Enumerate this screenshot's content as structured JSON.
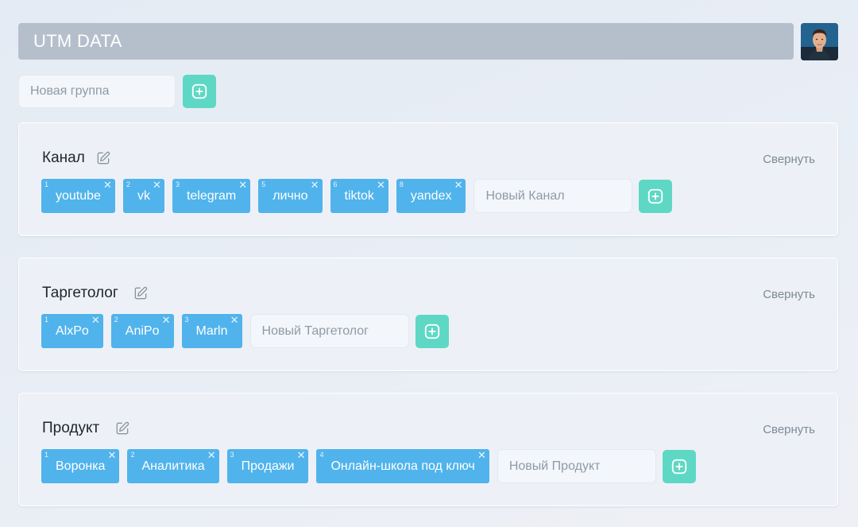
{
  "header": {
    "title": "UTM DATA"
  },
  "new_group": {
    "placeholder": "Новая группа"
  },
  "icons": {
    "add": "plus-square-icon",
    "edit": "pencil-square-icon",
    "remove": "close-icon",
    "avatar": "user-avatar"
  },
  "colors": {
    "tag": "#50b3ec",
    "add_button": "#5ed8c4",
    "header_bar": "#b5bfcc"
  },
  "groups": [
    {
      "title": "Канал",
      "collapse": "Свернуть",
      "tags": [
        {
          "num": "1",
          "label": "youtube"
        },
        {
          "num": "2",
          "label": "vk"
        },
        {
          "num": "3",
          "label": "telegram"
        },
        {
          "num": "5",
          "label": "лично"
        },
        {
          "num": "6",
          "label": "tiktok"
        },
        {
          "num": "8",
          "label": "yandex"
        }
      ],
      "new_placeholder": "Новый Канал"
    },
    {
      "title": "Таргетолог",
      "collapse": "Свернуть",
      "tags": [
        {
          "num": "1",
          "label": "AlxPo"
        },
        {
          "num": "2",
          "label": "AniPo"
        },
        {
          "num": "3",
          "label": "Marln"
        }
      ],
      "new_placeholder": "Новый Таргетолог"
    },
    {
      "title": "Продукт",
      "collapse": "Свернуть",
      "tags": [
        {
          "num": "1",
          "label": "Воронка"
        },
        {
          "num": "2",
          "label": "Аналитика"
        },
        {
          "num": "3",
          "label": "Продажи"
        },
        {
          "num": "4",
          "label": "Онлайн-школа под ключ"
        }
      ],
      "new_placeholder": "Новый Продукт"
    }
  ]
}
